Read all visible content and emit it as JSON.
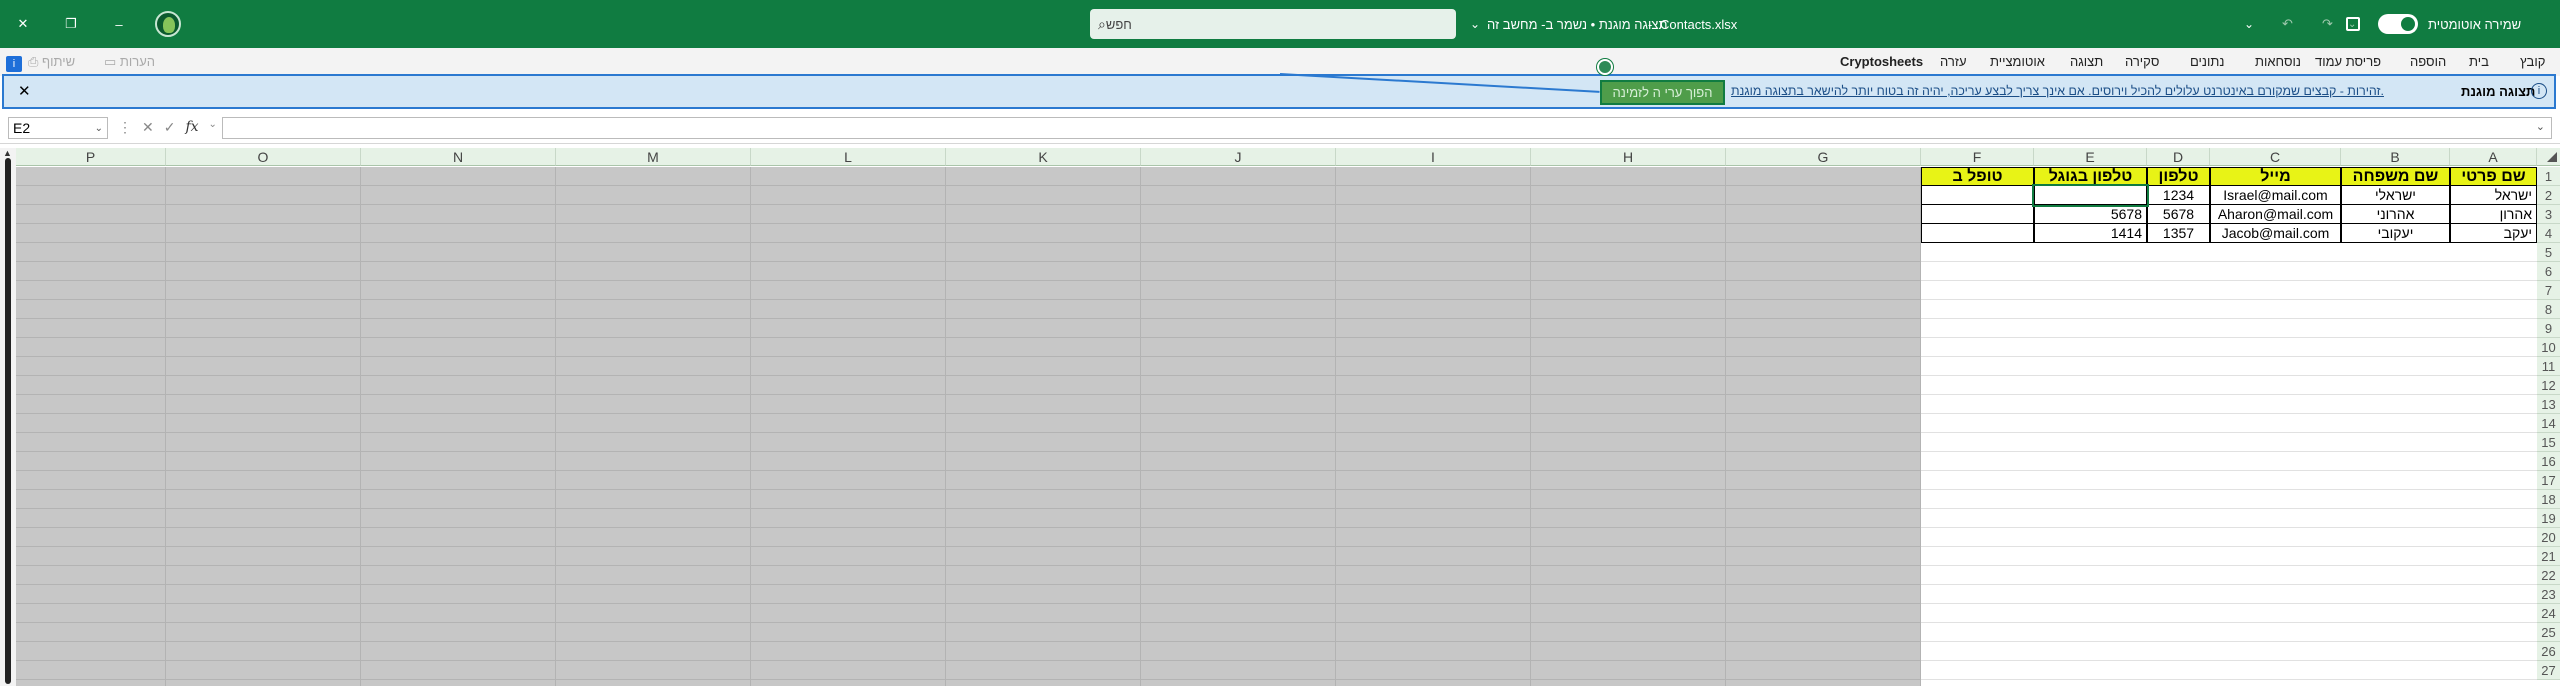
{
  "titlebar": {
    "autosave_label": "שמירה אוטומטית",
    "file_title": "Contacts.xlsx",
    "status": "תצוגה מוגנת • נשמר ב- מחשב זה",
    "search_placeholder": "חפש",
    "minimize": "–",
    "restore": "❐",
    "close": "✕"
  },
  "menu": {
    "items": [
      "קובץ",
      "בית",
      "הוספה",
      "פריסת עמוד",
      "נוסחאות",
      "נתונים",
      "סקירה",
      "תצוגה",
      "אוטומציית",
      "עזרה"
    ],
    "addin": "Cryptosheets",
    "comments": "הערות",
    "share": "שיתוף"
  },
  "banner": {
    "title": "תצוגה מוגנת",
    "message": "זהירות - קבצים שמקורם באינטרנט עלולים להכיל וירוסים. אם אינך צריך לבצע עריכה, יהיה זה בטוח יותר להישאר בתצוגה מוגנת.",
    "enable_editing": "הפוך ערי ה לזמינה",
    "close": "✕",
    "info_icon": "i"
  },
  "formula_bar": {
    "name_box": "E2",
    "fx": "fx",
    "value": ""
  },
  "grid": {
    "gray_columns": [
      "P",
      "O",
      "N",
      "M",
      "L",
      "K",
      "J",
      "I",
      "H",
      "G"
    ],
    "data_columns": [
      "F",
      "E",
      "D",
      "C",
      "B",
      "A"
    ],
    "row_numbers": [
      "1",
      "2",
      "3",
      "4",
      "5",
      "6",
      "7",
      "8",
      "9",
      "10",
      "11",
      "12",
      "13",
      "14",
      "15",
      "16",
      "17",
      "18",
      "19",
      "20",
      "21",
      "22",
      "23",
      "24",
      "25",
      "26",
      "27"
    ],
    "headers": {
      "A": "שם פרטי",
      "B": "שם משפחה",
      "C": "מייל",
      "D": "טלפון",
      "E": "טלפון בגוגל",
      "F": "טופל ב"
    },
    "rows": [
      {
        "A": "ישראל",
        "B": "ישראלי",
        "C": "Israel@mail.com",
        "D": "1234",
        "E": "",
        "F": ""
      },
      {
        "A": "אהרון",
        "B": "אהרוני",
        "C": "Aharon@mail.com",
        "D": "5678",
        "E": "5678",
        "F": ""
      },
      {
        "A": "יעקב",
        "B": "יעקובי",
        "C": "Jacob@mail.com",
        "D": "1357",
        "E": "1414",
        "F": ""
      }
    ]
  },
  "colors": {
    "brand": "#107c41",
    "header_fill": "#e8f316",
    "banner_bg": "#d3e6f5"
  }
}
